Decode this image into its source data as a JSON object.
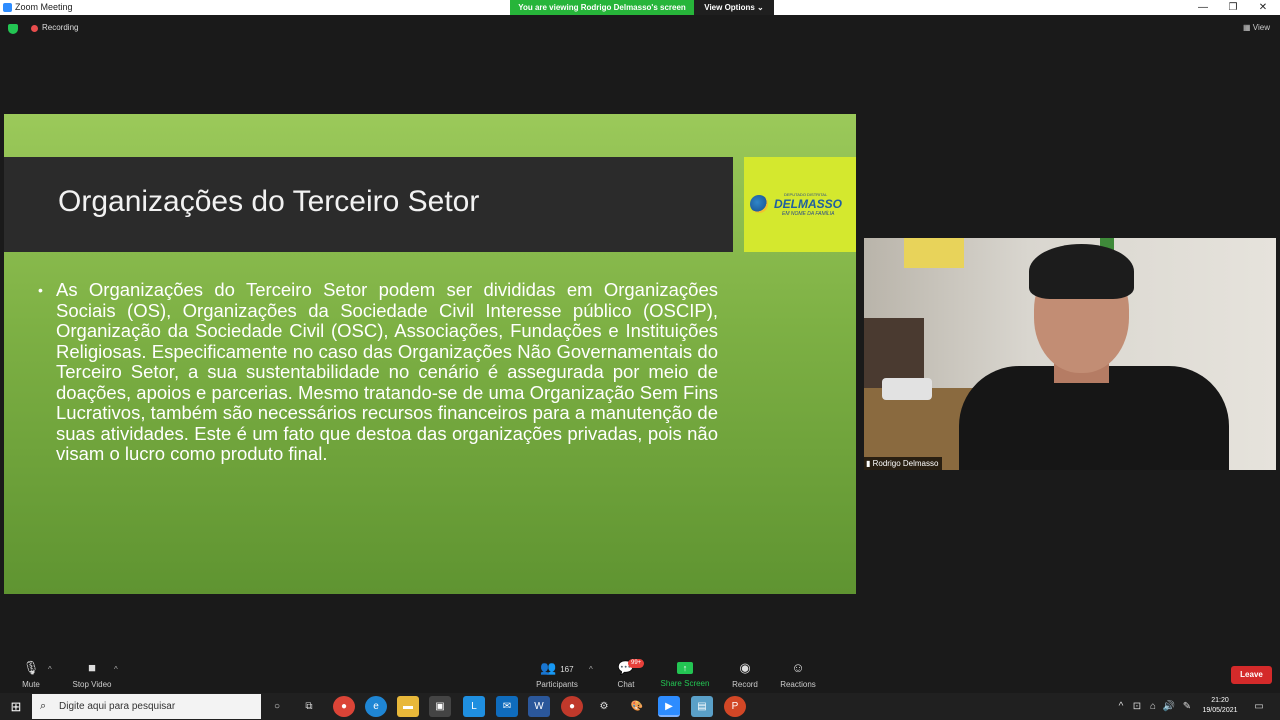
{
  "window": {
    "title": "Zoom Meeting",
    "viewing_banner": "You are viewing Rodrigo Delmasso's screen",
    "view_options": "View Options",
    "min": "—",
    "max": "❐",
    "close": "✕"
  },
  "topbar": {
    "recording": "Recording",
    "view": "View"
  },
  "slide": {
    "title": "Organizações do Terceiro Setor",
    "logo_small": "DEPUTADO DISTRITAL",
    "logo_name": "DELMASSO",
    "logo_sub": "EM NOME DA FAMÍLIA",
    "body": "As Organizações do Terceiro Setor podem ser divididas em Organizações Sociais (OS), Organizações da Sociedade Civil Interesse público (OSCIP), Organização da Sociedade Civil (OSC), Associações, Fundações e Instituições Religiosas. Especificamente no caso das Organizações Não Governamentais do Terceiro Setor, a sua sustentabilidade no cenário é assegurada por meio de doações, apoios e parcerias. Mesmo tratando-se de uma Organização Sem Fins Lucrativos, também são necessários recursos financeiros para a manutenção de suas atividades. Este é um fato que destoa das organizações privadas, pois não visam o lucro como produto final."
  },
  "video": {
    "participant_name": "Rodrigo Delmasso"
  },
  "toolbar": {
    "mute": "Mute",
    "stop_video": "Stop Video",
    "participants": "Participants",
    "participants_count": "167",
    "chat": "Chat",
    "chat_badge": "99+",
    "share_screen": "Share Screen",
    "record": "Record",
    "reactions": "Reactions",
    "leave": "Leave"
  },
  "taskbar": {
    "search_placeholder": "Digite aqui para pesquisar",
    "time": "21:20",
    "date": "19/05/2021"
  },
  "colors": {
    "zoom_blue": "#2d8cff",
    "banner_green": "#27b53a",
    "leave_red": "#d42a2a",
    "slide_green": "#7db044"
  }
}
